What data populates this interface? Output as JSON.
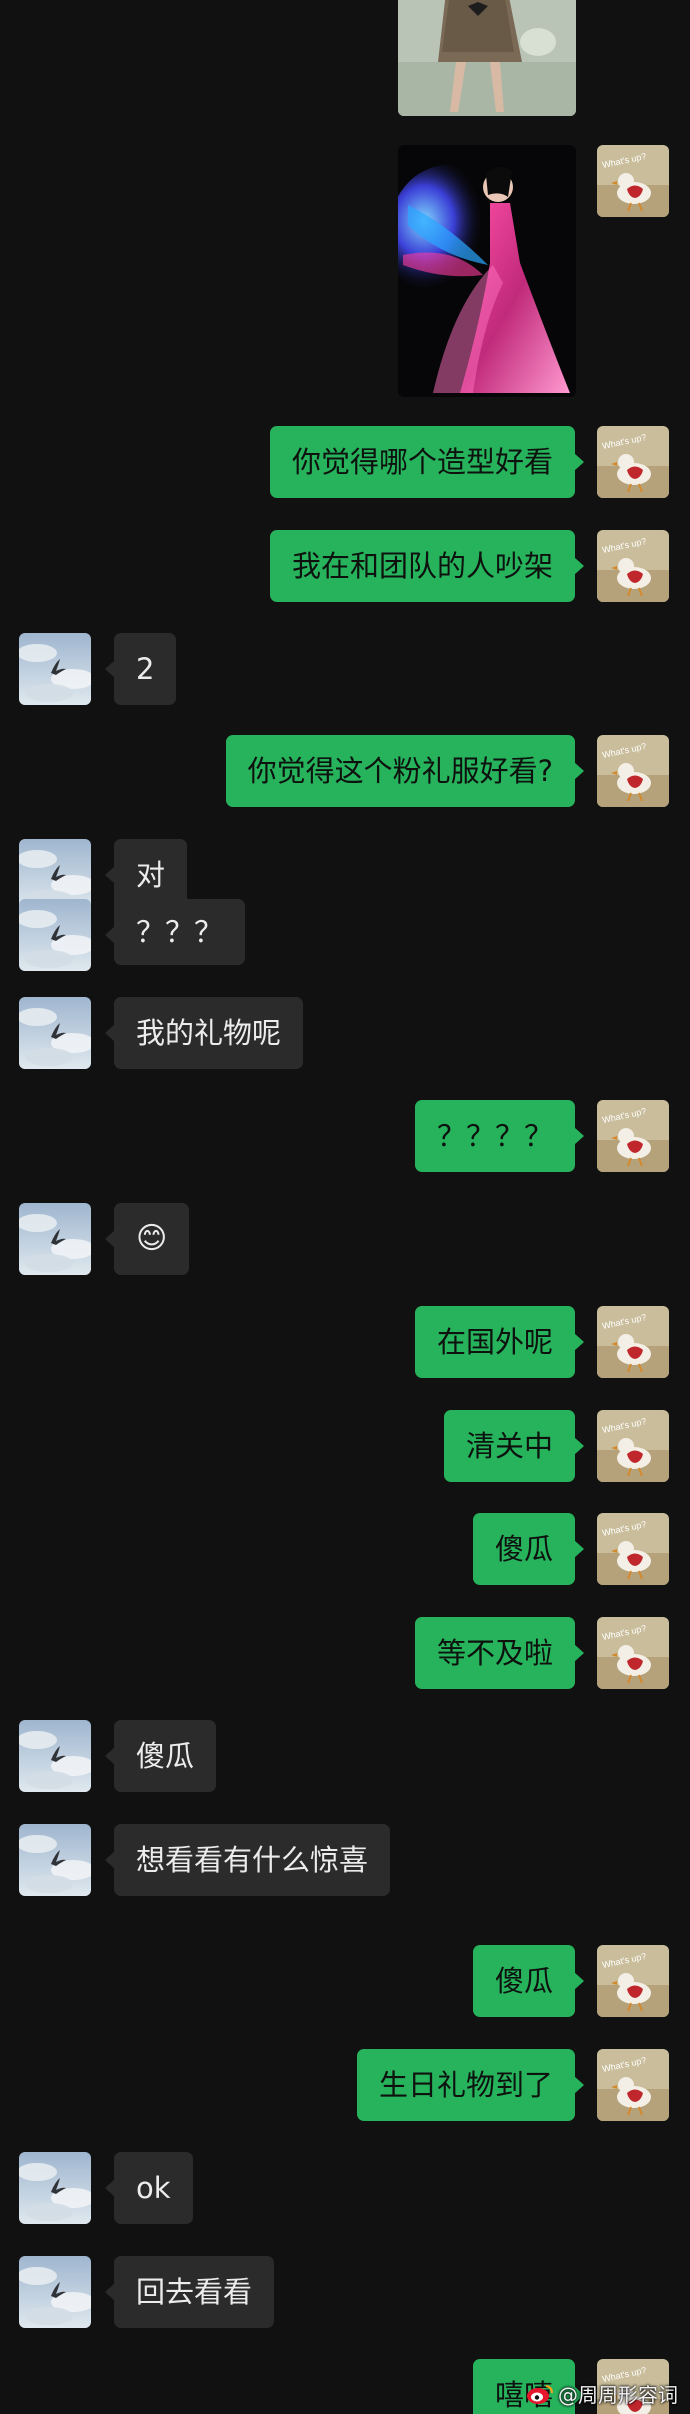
{
  "chat": {
    "messages": [
      {
        "sender": "me",
        "type": "image",
        "image": "photo-woman-plaid-dress"
      },
      {
        "sender": "me",
        "type": "image",
        "image": "photo-woman-glowing-gown"
      },
      {
        "sender": "me",
        "type": "text",
        "text": "你觉得哪个造型好看"
      },
      {
        "sender": "me",
        "type": "text",
        "text": "我在和团队的人吵架"
      },
      {
        "sender": "other",
        "type": "text",
        "text": "2"
      },
      {
        "sender": "me",
        "type": "text",
        "text": "你觉得这个粉礼服好看?"
      },
      {
        "sender": "other",
        "type": "text",
        "text": "对"
      },
      {
        "sender": "other",
        "type": "text",
        "text": "？？？"
      },
      {
        "sender": "other",
        "type": "text",
        "text": "我的礼物呢"
      },
      {
        "sender": "me",
        "type": "text",
        "text": "？？？？"
      },
      {
        "sender": "other",
        "type": "emoji",
        "text": "😊"
      },
      {
        "sender": "me",
        "type": "text",
        "text": "在国外呢"
      },
      {
        "sender": "me",
        "type": "text",
        "text": "清关中"
      },
      {
        "sender": "me",
        "type": "text",
        "text": "傻瓜"
      },
      {
        "sender": "me",
        "type": "text",
        "text": "等不及啦"
      },
      {
        "sender": "other",
        "type": "text",
        "text": "傻瓜"
      },
      {
        "sender": "other",
        "type": "text",
        "text": "想看看有什么惊喜"
      },
      {
        "sender": "me",
        "type": "text",
        "text": "傻瓜"
      },
      {
        "sender": "me",
        "type": "text",
        "text": "生日礼物到了"
      },
      {
        "sender": "other",
        "type": "text",
        "text": "ok"
      },
      {
        "sender": "other",
        "type": "text",
        "text": "回去看看"
      },
      {
        "sender": "me",
        "type": "text",
        "text": "嘻嘻"
      }
    ]
  },
  "avatars": {
    "me": {
      "icon": "avatar-duck-whats-up",
      "caption": "What's up?"
    },
    "other": {
      "icon": "avatar-sky-bird"
    }
  },
  "watermark": {
    "text": "@周周形容词"
  },
  "colors": {
    "background": "#111111",
    "my_bubble": "#26b35c",
    "their_bubble": "#2b2b2b"
  }
}
